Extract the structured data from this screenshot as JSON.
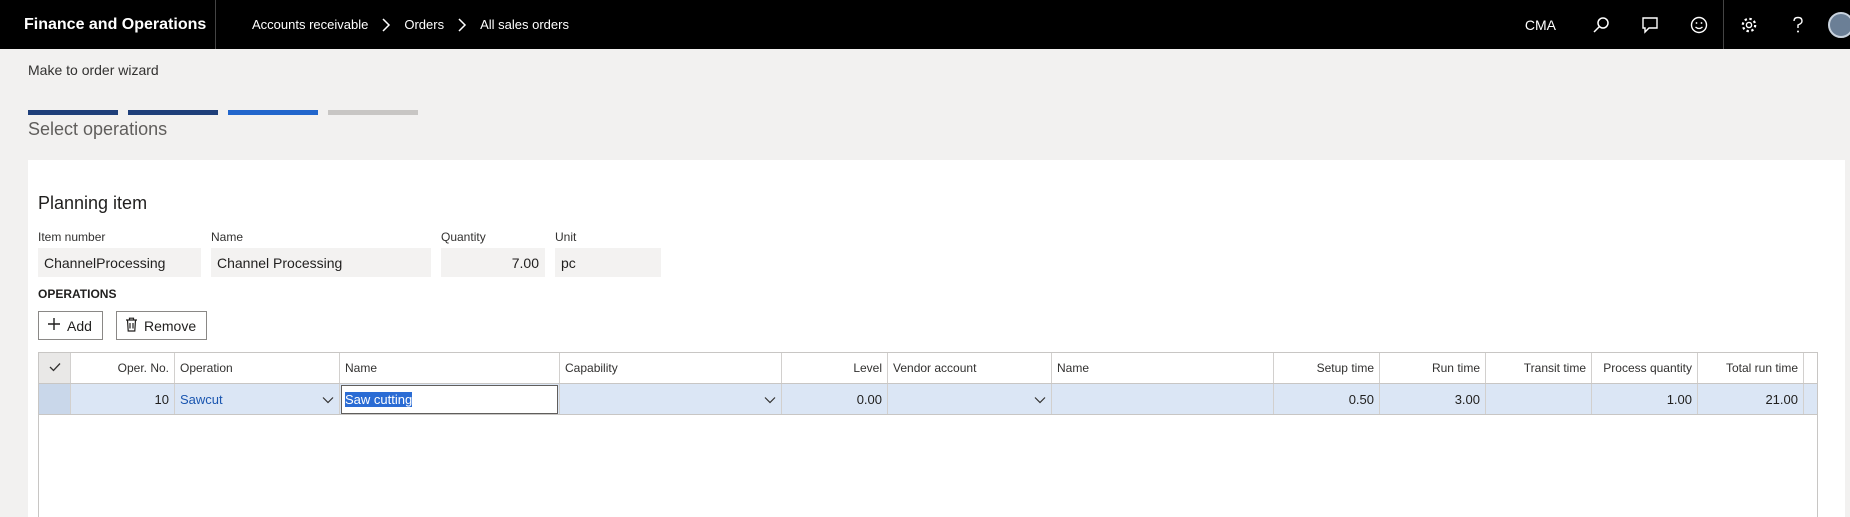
{
  "app": {
    "title": "Finance and Operations"
  },
  "breadcrumb": [
    "Accounts receivable",
    "Orders",
    "All sales orders"
  ],
  "header": {
    "company": "CMA"
  },
  "wizard": {
    "title": "Make to order wizard",
    "step_title": "Select operations",
    "steps": [
      "done",
      "done",
      "active",
      "pending"
    ]
  },
  "planning_item": {
    "section_title": "Planning item",
    "item_number": {
      "label": "Item number",
      "value": "ChannelProcessing"
    },
    "name": {
      "label": "Name",
      "value": "Channel Processing"
    },
    "quantity": {
      "label": "Quantity",
      "value": "7.00"
    },
    "unit": {
      "label": "Unit",
      "value": "pc"
    }
  },
  "operations": {
    "label": "OPERATIONS",
    "add_label": "Add",
    "remove_label": "Remove",
    "columns": [
      "Oper. No.",
      "Operation",
      "Name",
      "Capability",
      "Level",
      "Vendor account",
      "Name",
      "Setup time",
      "Run time",
      "Transit time",
      "Process quantity",
      "Total run time"
    ],
    "rows": [
      {
        "oper_no": "10",
        "operation": "Sawcut",
        "name": "Saw cutting",
        "capability": "",
        "level": "0.00",
        "vendor_account": "",
        "vendor_name": "",
        "setup_time": "0.50",
        "run_time": "3.00",
        "transit_time": "",
        "process_quantity": "1.00",
        "total_run_time": "21.00"
      }
    ]
  },
  "icons": [
    "search-icon",
    "chat-icon",
    "smiley-icon",
    "gear-icon",
    "help-icon",
    "chevron-right-icon",
    "plus-icon",
    "trash-icon",
    "checkmark-icon",
    "chevron-down-icon"
  ],
  "colors": {
    "topbar": "#000000",
    "step_done": "#1f3f7a",
    "step_active": "#2266cc",
    "row_selected": "#dbe6f5",
    "link": "#1a56b0"
  }
}
